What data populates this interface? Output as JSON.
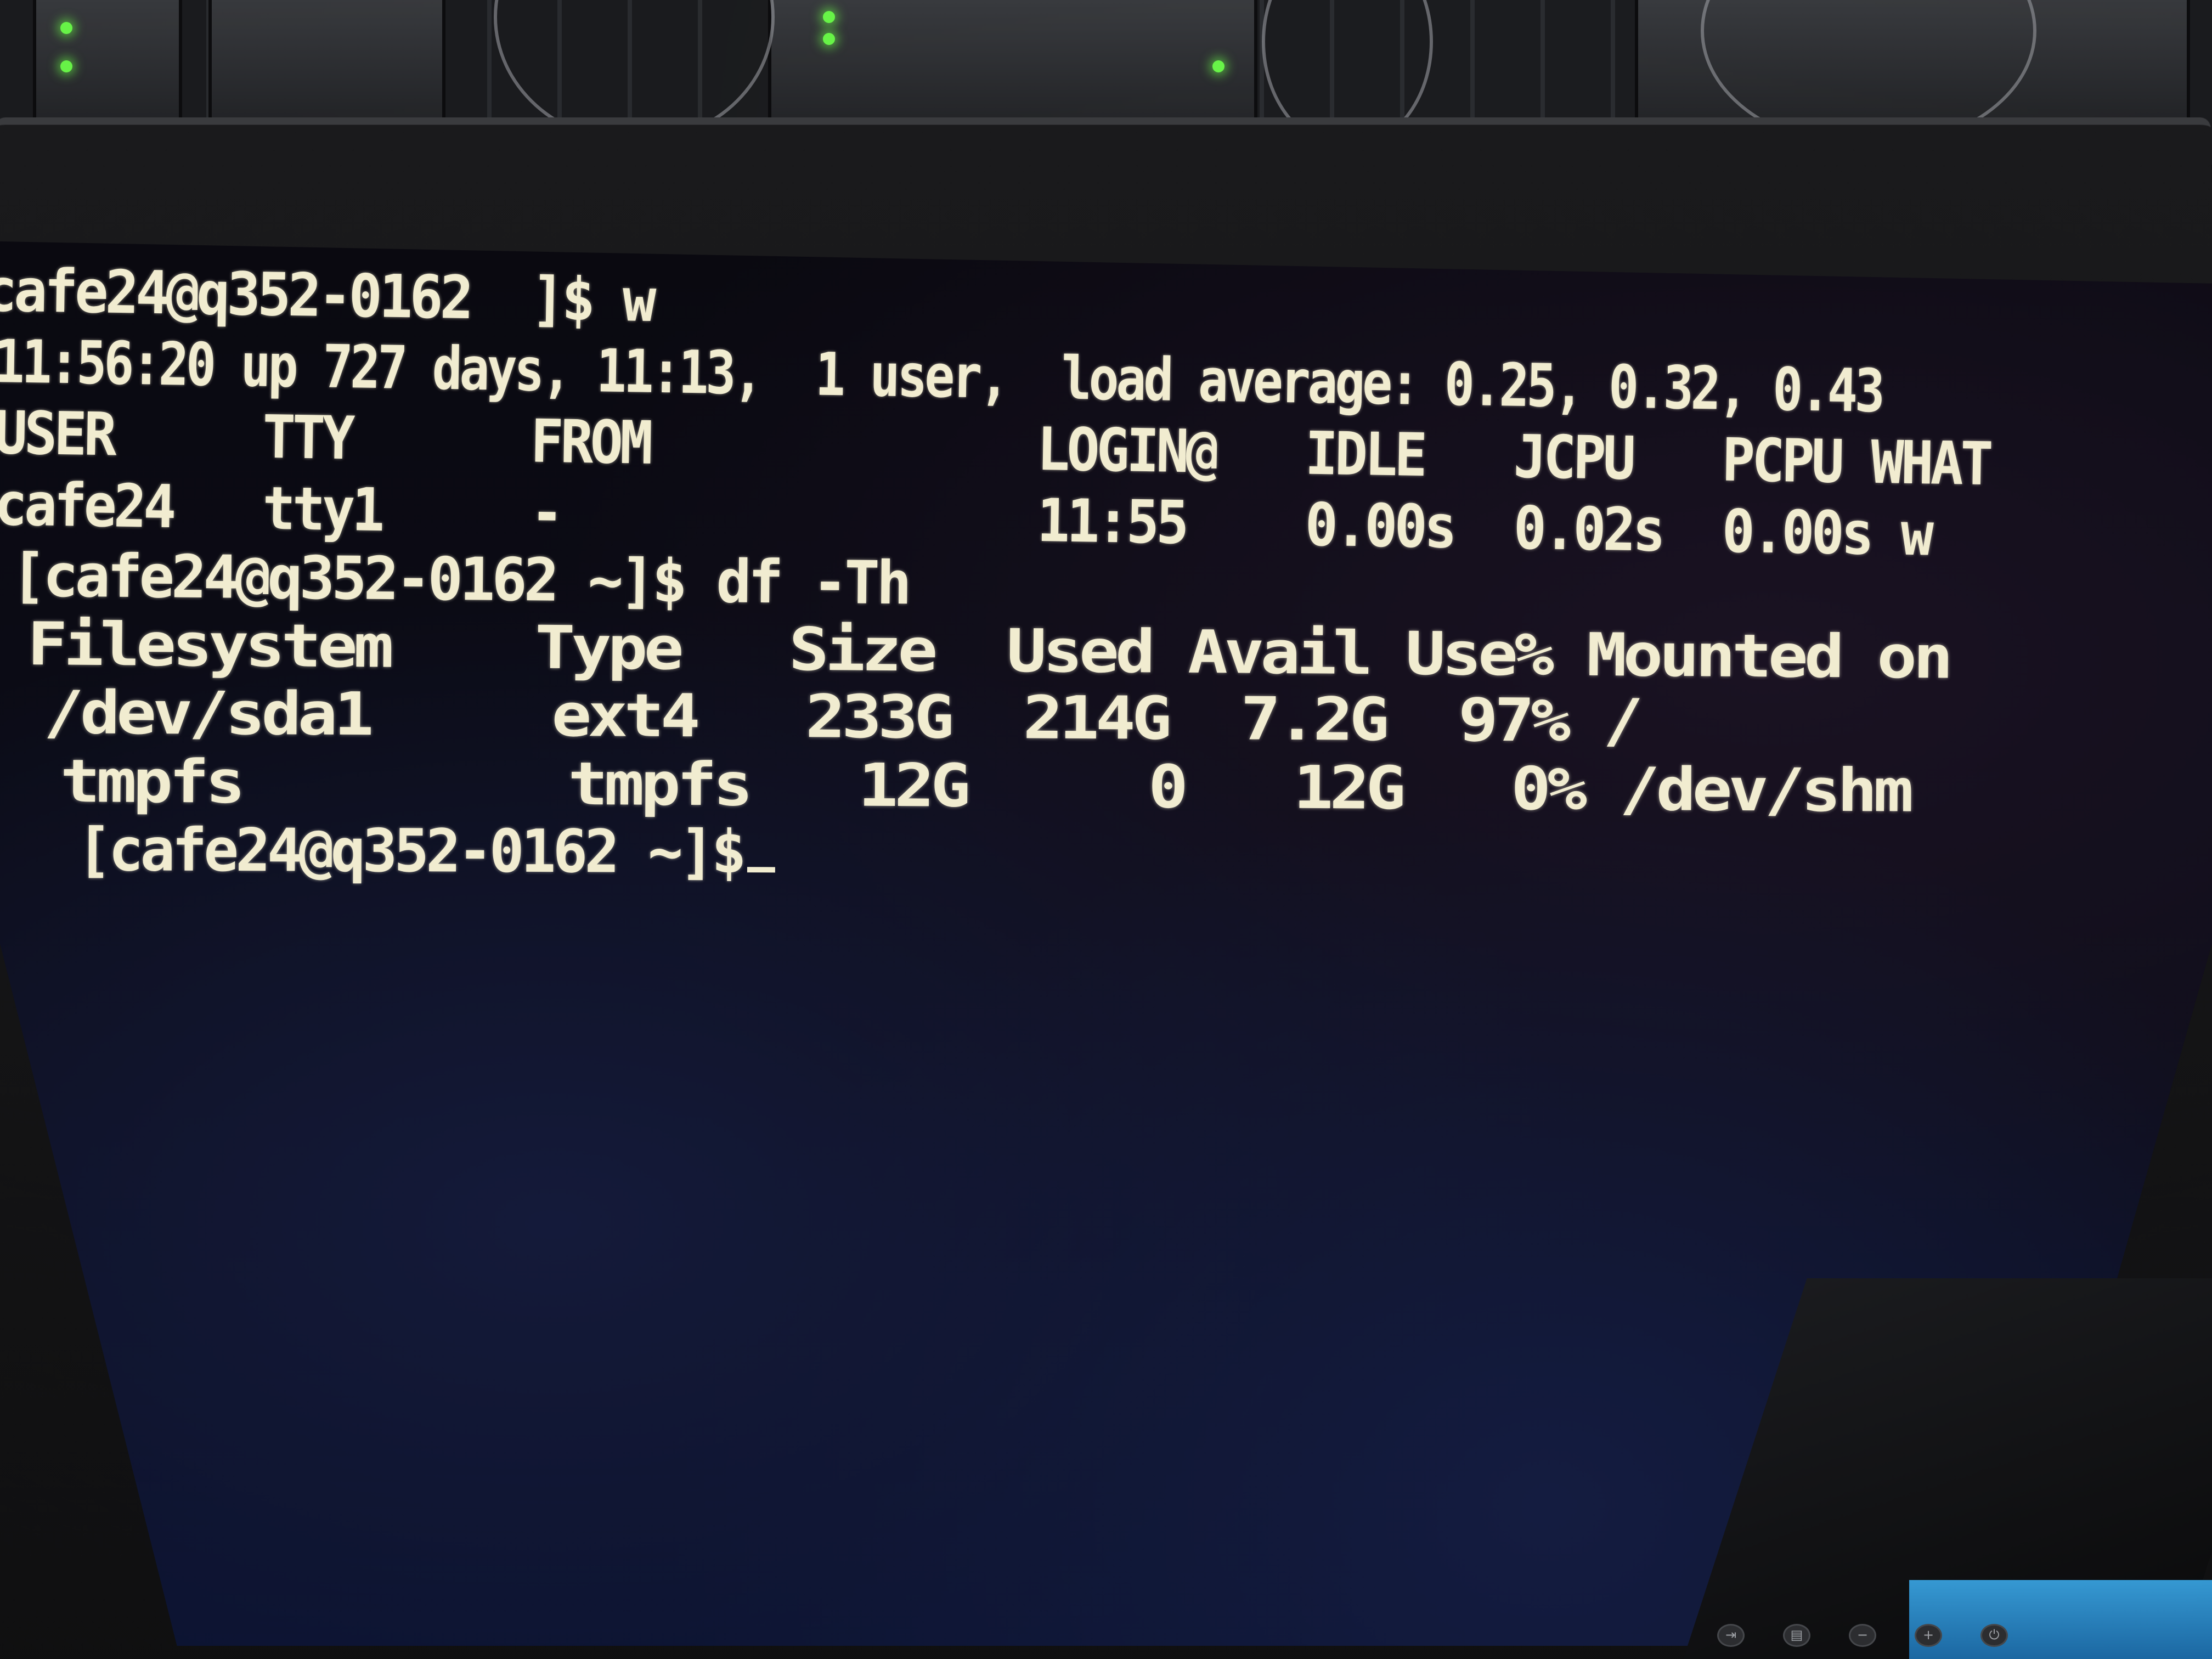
{
  "terminal": {
    "lines": [
      "cafe24@q352-0162  ]$ w",
      "11:56:20 up 727 days, 11:13,  1 user,  load average: 0.25, 0.32, 0.43",
      "USER     TTY      FROM             LOGIN@   IDLE   JCPU   PCPU WHAT",
      "cafe24   tty1     -                11:55    0.00s  0.02s  0.00s w",
      "[cafe24@q352-0162 ~]$ df -Th",
      "Filesystem    Type   Size  Used Avail Use% Mounted on",
      "/dev/sda1     ext4   233G  214G  7.2G  97% /",
      "tmpfs         tmpfs   12G     0   12G   0% /dev/shm",
      "[cafe24@q352-0162 ~]$"
    ]
  },
  "monitor": {
    "button_icons": [
      "input-icon",
      "menu-icon",
      "minus-icon",
      "plus-icon",
      "power-icon"
    ],
    "button_glyphs": [
      "⇥",
      "▤",
      "−",
      "+",
      "⏻"
    ]
  }
}
